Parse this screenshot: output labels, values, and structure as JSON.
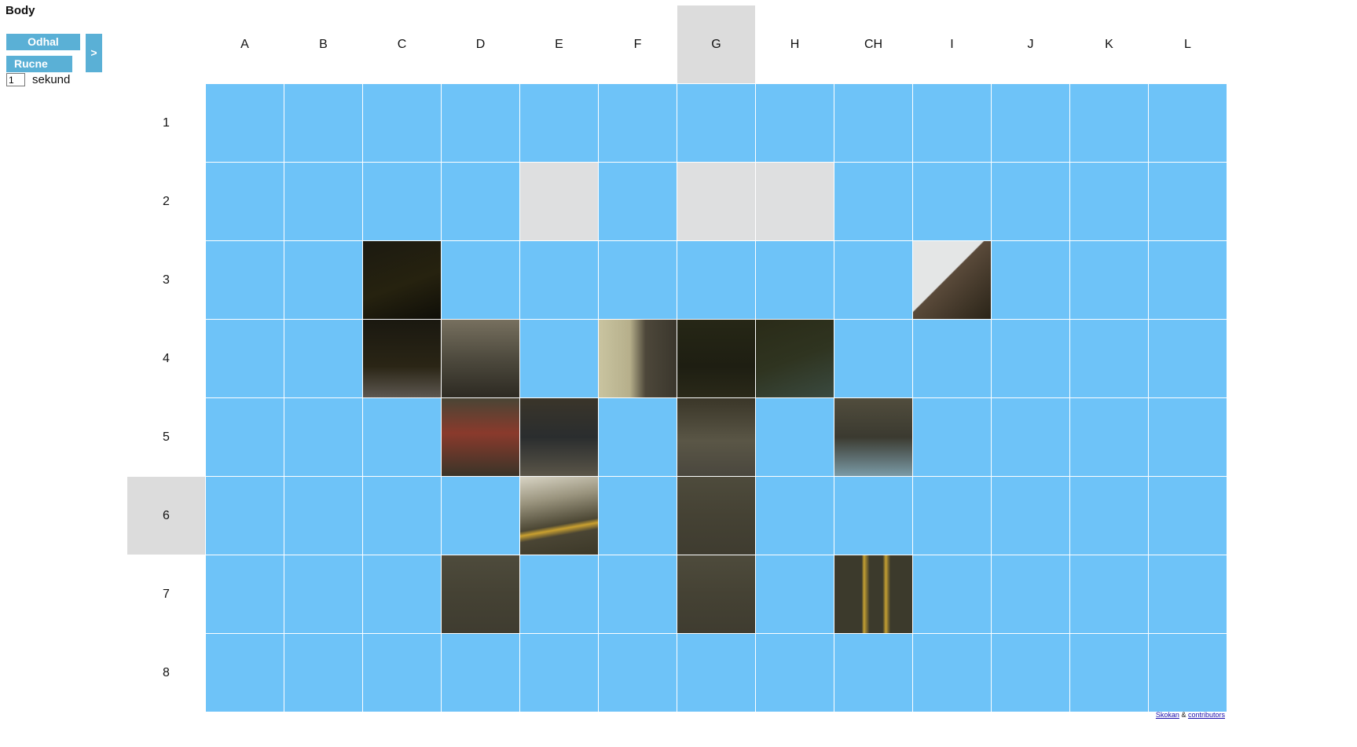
{
  "title": "Body",
  "controls": {
    "reveal_label": "Odhal",
    "manual_label": "Rucne",
    "next_label": ">",
    "seconds_value": "1",
    "seconds_label": "sekund"
  },
  "grid": {
    "columns": [
      "A",
      "B",
      "C",
      "D",
      "E",
      "F",
      "G",
      "H",
      "CH",
      "I",
      "J",
      "K",
      "L"
    ],
    "rows": [
      "1",
      "2",
      "3",
      "4",
      "5",
      "6",
      "7",
      "8"
    ],
    "highlighted_column": "G",
    "highlighted_row": "6",
    "revealed_cells": [
      {
        "col": "E",
        "row": "2",
        "kind": "sky-antenna"
      },
      {
        "col": "G",
        "row": "2",
        "kind": "sky"
      },
      {
        "col": "H",
        "row": "2",
        "kind": "sky"
      },
      {
        "col": "C",
        "row": "3",
        "kind": "dark-building"
      },
      {
        "col": "I",
        "row": "3",
        "kind": "sky-roof"
      },
      {
        "col": "C",
        "row": "4",
        "kind": "dark-wall"
      },
      {
        "col": "D",
        "row": "4",
        "kind": "stone-house"
      },
      {
        "col": "F",
        "row": "4",
        "kind": "cream-house"
      },
      {
        "col": "G",
        "row": "4",
        "kind": "trees"
      },
      {
        "col": "H",
        "row": "4",
        "kind": "trees-light"
      },
      {
        "col": "D",
        "row": "5",
        "kind": "red-car"
      },
      {
        "col": "E",
        "row": "5",
        "kind": "dark-car"
      },
      {
        "col": "G",
        "row": "5",
        "kind": "street-end"
      },
      {
        "col": "CH",
        "row": "5",
        "kind": "people-car"
      },
      {
        "col": "E",
        "row": "6",
        "kind": "road-lines"
      },
      {
        "col": "G",
        "row": "6",
        "kind": "road"
      },
      {
        "col": "D",
        "row": "7",
        "kind": "road"
      },
      {
        "col": "G",
        "row": "7",
        "kind": "road"
      },
      {
        "col": "CH",
        "row": "7",
        "kind": "road-yellow"
      }
    ]
  },
  "footer": {
    "link1": "Skokan",
    "separator": "&",
    "link2": "contributors"
  }
}
